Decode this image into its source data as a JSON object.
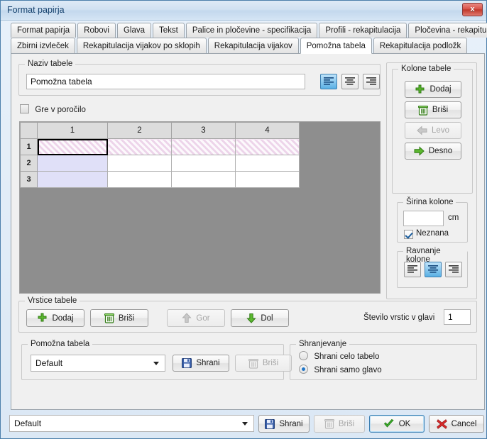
{
  "window": {
    "title": "Format papirja",
    "close_label": "x"
  },
  "tabs": {
    "row1": [
      {
        "label": "Format papirja",
        "active": false
      },
      {
        "label": "Robovi",
        "active": false
      },
      {
        "label": "Glava",
        "active": false
      },
      {
        "label": "Tekst",
        "active": false
      },
      {
        "label": "Palice in pločevine - specifikacija",
        "active": false
      },
      {
        "label": "Profili - rekapitulacija",
        "active": false
      },
      {
        "label": "Pločevina - rekapitulacija",
        "active": false
      }
    ],
    "row2": [
      {
        "label": "Zbirni izvleček",
        "active": false
      },
      {
        "label": "Rekapitulacija vijakov po sklopih",
        "active": false
      },
      {
        "label": "Rekapitulacija vijakov",
        "active": false
      },
      {
        "label": "Pomožna tabela",
        "active": true
      },
      {
        "label": "Rekapitulacija podložk",
        "active": false
      }
    ]
  },
  "table_name": {
    "legend": "Naziv tabele",
    "value": "Pomožna tabela",
    "align_buttons": [
      {
        "icon": "align-left-icon",
        "selected": true
      },
      {
        "icon": "align-center-icon",
        "selected": false
      },
      {
        "icon": "align-right-icon",
        "selected": false
      }
    ]
  },
  "report_checkbox": {
    "label": "Gre v poročilo",
    "checked": false
  },
  "grid": {
    "column_headers": [
      "",
      "1",
      "2",
      "3",
      "4"
    ],
    "rows": [
      {
        "header": "1",
        "cells": [
          "",
          "",
          "",
          ""
        ],
        "style": "hatch"
      },
      {
        "header": "2",
        "cells": [
          "",
          "",
          "",
          ""
        ],
        "style": "normal"
      },
      {
        "header": "3",
        "cells": [
          "",
          "",
          "",
          ""
        ],
        "style": "normal"
      }
    ],
    "focused_cell": {
      "row": 1,
      "col": 1
    }
  },
  "columns_panel": {
    "legend": "Kolone tabele",
    "buttons": [
      {
        "label": "Dodaj",
        "icon": "plus-icon",
        "enabled": true
      },
      {
        "label": "Briši",
        "icon": "trash-icon",
        "enabled": true
      },
      {
        "label": "Levo",
        "icon": "arrow-left-icon",
        "enabled": false
      },
      {
        "label": "Desno",
        "icon": "arrow-right-icon",
        "enabled": true
      }
    ]
  },
  "column_width": {
    "legend": "Širina kolone",
    "value": "",
    "unit": "cm",
    "unknown_checkbox": {
      "label": "Neznana",
      "checked": true
    }
  },
  "column_align": {
    "legend": "Ravnanje kolone",
    "buttons": [
      {
        "icon": "align-left-icon",
        "selected": false
      },
      {
        "icon": "align-center-icon",
        "selected": true
      },
      {
        "icon": "align-right-icon",
        "selected": false
      }
    ]
  },
  "rows_panel": {
    "legend": "Vrstice tabele",
    "buttons": [
      {
        "label": "Dodaj",
        "icon": "plus-icon",
        "enabled": true
      },
      {
        "label": "Briši",
        "icon": "trash-icon",
        "enabled": true
      },
      {
        "label": "Gor",
        "icon": "arrow-up-icon",
        "enabled": false
      },
      {
        "label": "Dol",
        "icon": "arrow-down-icon",
        "enabled": true
      }
    ],
    "header_rows_label": "Število vrstic v glavi",
    "header_rows_value": "1"
  },
  "preset_panel": {
    "legend": "Pomožna tabela",
    "selected": "Default",
    "save_label": "Shrani",
    "delete_label": "Briši",
    "delete_enabled": false
  },
  "saving_panel": {
    "legend": "Shranjevanje",
    "options": [
      {
        "label": "Shrani celo tabelo",
        "selected": false
      },
      {
        "label": "Shrani samo glavo",
        "selected": true
      }
    ]
  },
  "footer": {
    "selected": "Default",
    "save_label": "Shrani",
    "delete_label": "Briši",
    "delete_enabled": false,
    "ok_label": "OK",
    "cancel_label": "Cancel"
  }
}
